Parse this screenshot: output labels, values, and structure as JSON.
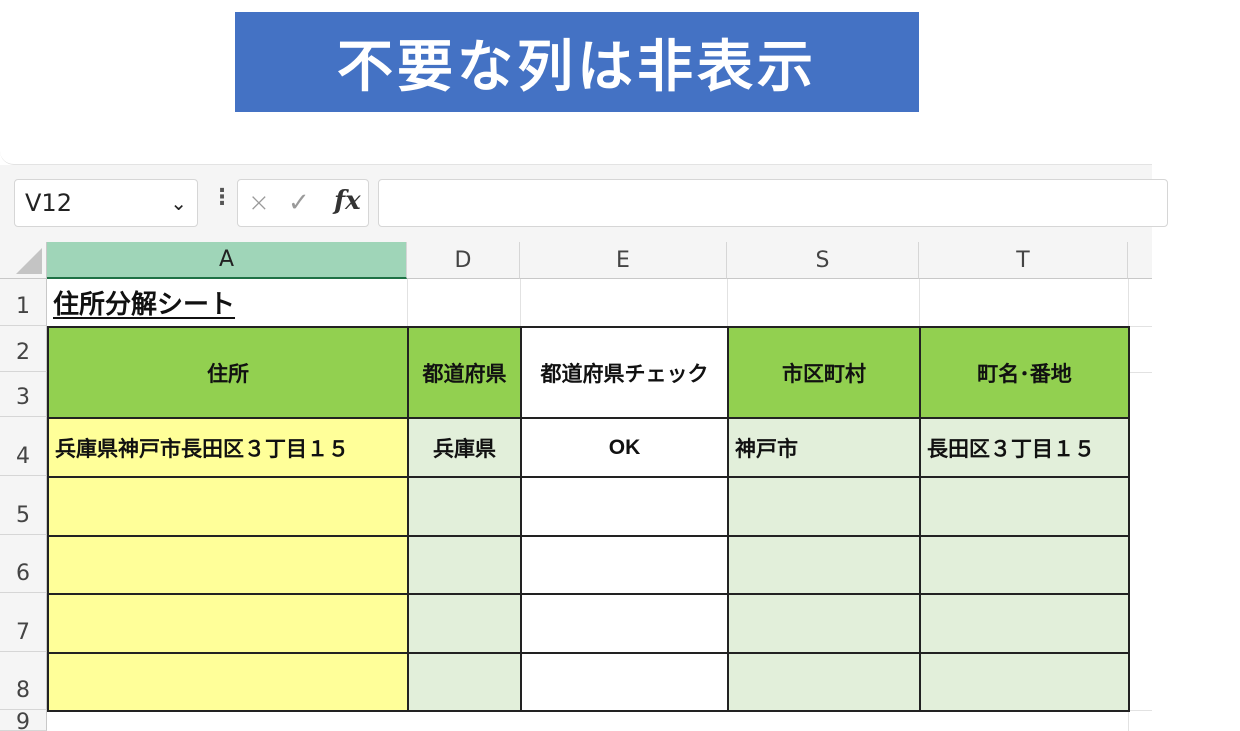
{
  "banner": {
    "title": "不要な列は非表示"
  },
  "formula_bar": {
    "name_box": "V12",
    "chevron_icon": "chevron-down-icon",
    "cancel_icon": "×",
    "confirm_icon": "✓",
    "fx_label": "fx",
    "formula": ""
  },
  "columns": [
    "A",
    "D",
    "E",
    "S",
    "T"
  ],
  "rows": [
    "1",
    "2",
    "3",
    "4",
    "5",
    "6",
    "7",
    "8",
    "9"
  ],
  "sheet": {
    "title": "住所分解シート",
    "headers": {
      "address": "住所",
      "prefecture": "都道府県",
      "prefecture_check": "都道府県チェック",
      "city": "市区町村",
      "town": "町名･番地"
    },
    "row4": {
      "address": "兵庫県神戸市長田区３丁目１５",
      "prefecture": "兵庫県",
      "prefecture_check": "OK",
      "city": "神戸市",
      "town": "長田区３丁目１５"
    }
  },
  "colors": {
    "banner": "#4472c4",
    "header_green": "#92d050",
    "input_yellow": "#ffff99",
    "light_green": "#e2efda",
    "selected_col": "#9fd5b8"
  }
}
